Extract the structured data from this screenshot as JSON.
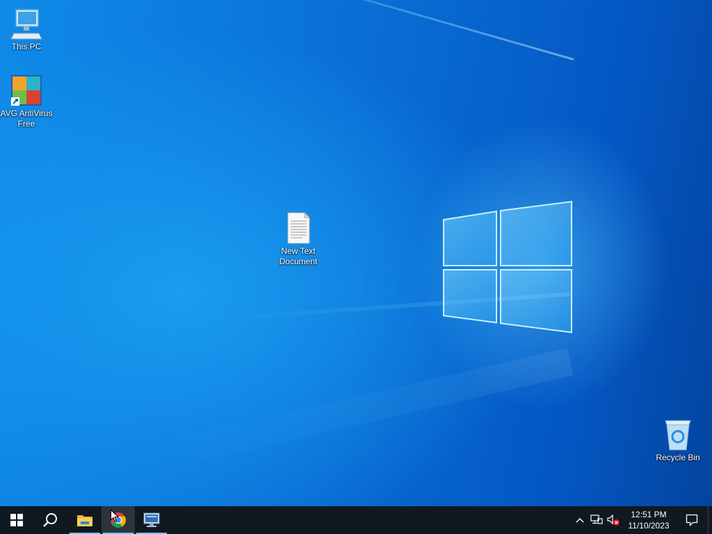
{
  "desktop": {
    "icons": [
      {
        "label": "This PC",
        "icon": "this-pc-icon"
      },
      {
        "label": "AVG AntiVirus Free",
        "icon": "avg-antivirus-icon"
      },
      {
        "label": "New Text Document",
        "icon": "text-document-icon"
      },
      {
        "label": "Recycle Bin",
        "icon": "recycle-bin-icon"
      }
    ]
  },
  "taskbar": {
    "buttons": [
      {
        "name": "start",
        "icon": "windows-start-icon"
      },
      {
        "name": "search",
        "icon": "search-icon"
      },
      {
        "name": "file-explorer",
        "icon": "folder-icon",
        "running": true
      },
      {
        "name": "chrome",
        "icon": "chrome-icon",
        "running": true
      },
      {
        "name": "remote-desktop",
        "icon": "monitor-icon",
        "running": true
      }
    ],
    "tray": {
      "icons": [
        "chevron-up-icon",
        "network-icon",
        "volume-muted-icon"
      ],
      "time": "12:51 PM",
      "date": "11/10/2023",
      "notification_icon": "action-center-icon"
    }
  },
  "colors": {
    "taskbar": "#101820",
    "running_indicator": "#76b9ed",
    "desktop_accent": "#0a6fd6"
  }
}
